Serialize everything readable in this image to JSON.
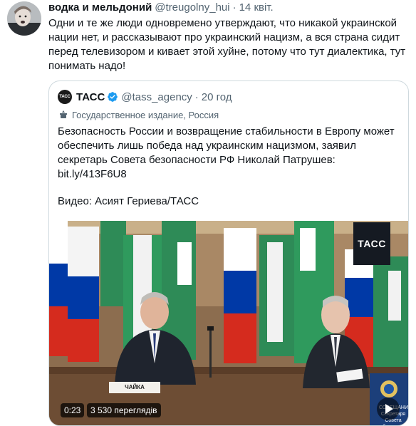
{
  "tweet": {
    "author_name": "водка и мельдоний",
    "author_handle": "@treugolny_hui",
    "separator": "·",
    "time": "14 квіт.",
    "text": "Одни  и те же люди одновремено утверждают, что никакой украинской нации нет, и рассказывают про украинский нацизм, а вся страна сидит перед телевизором и кивает этой хуйне, потому что тут диалектика, тут понимать надо!"
  },
  "quote": {
    "avatar_text": "ТАСС",
    "author_name": "ТАСС",
    "author_handle": "@tass_agency",
    "separator": "·",
    "time": "20 год",
    "label": "Государственное издание, Россия",
    "text": "Безопасность России и возвращение стабильности в Европу может обеспечить лишь победа над украинским нацизмом, заявил секретарь Совета безопасности РФ Николай Патрушев:",
    "link": "bit.ly/413F6U8",
    "video_credit": "Видео: Асият Гериева/ТАСС"
  },
  "video": {
    "watermark": "ТАСС",
    "nameplate": "ЧАЙКА",
    "screen_text_1": "СОВЕЩАНИЕ",
    "screen_text_2": "Секретаря Совета безопасн",
    "duration": "0:23",
    "views": "3 530 переглядів"
  },
  "colors": {
    "text": "#0f1419",
    "secondary": "#536471",
    "border": "#cfd9de",
    "verified": "#1d9bf0",
    "flag_red": "#d52b1e",
    "flag_blue": "#0039a6",
    "flag_green": "#2e8b57"
  },
  "icons": {
    "verified": "verified-badge-icon",
    "state_media": "state-media-icon",
    "play": "play-icon"
  }
}
